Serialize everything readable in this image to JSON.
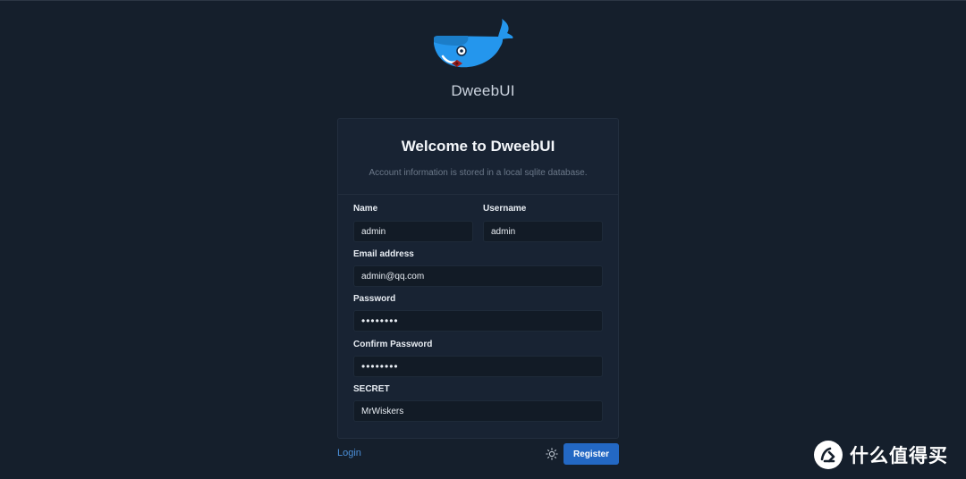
{
  "brand": {
    "name": "DweebUI",
    "logo_icon": "docker-whale-logo-icon"
  },
  "card": {
    "title": "Welcome to DweebUI",
    "subtitle": "Account information is stored in a local sqlite database."
  },
  "form": {
    "name": {
      "label": "Name",
      "value": "admin"
    },
    "username": {
      "label": "Username",
      "value": "admin"
    },
    "email": {
      "label": "Email address",
      "value": "admin@qq.com"
    },
    "password": {
      "label": "Password",
      "value": "adminpwd"
    },
    "confirm_password": {
      "label": "Confirm Password",
      "value": "adminpwd"
    },
    "secret": {
      "label": "SECRET",
      "value": "MrWiskers"
    }
  },
  "footer": {
    "login_label": "Login",
    "theme_icon": "sun-icon",
    "register_label": "Register"
  },
  "watermark": {
    "text": "什么值得买",
    "icon": "smzdm-logo-icon"
  },
  "colors": {
    "background": "#151f2c",
    "card": "#182333",
    "accent": "#2368c4",
    "link": "#4b8fd8",
    "whale": "#2496ed"
  }
}
